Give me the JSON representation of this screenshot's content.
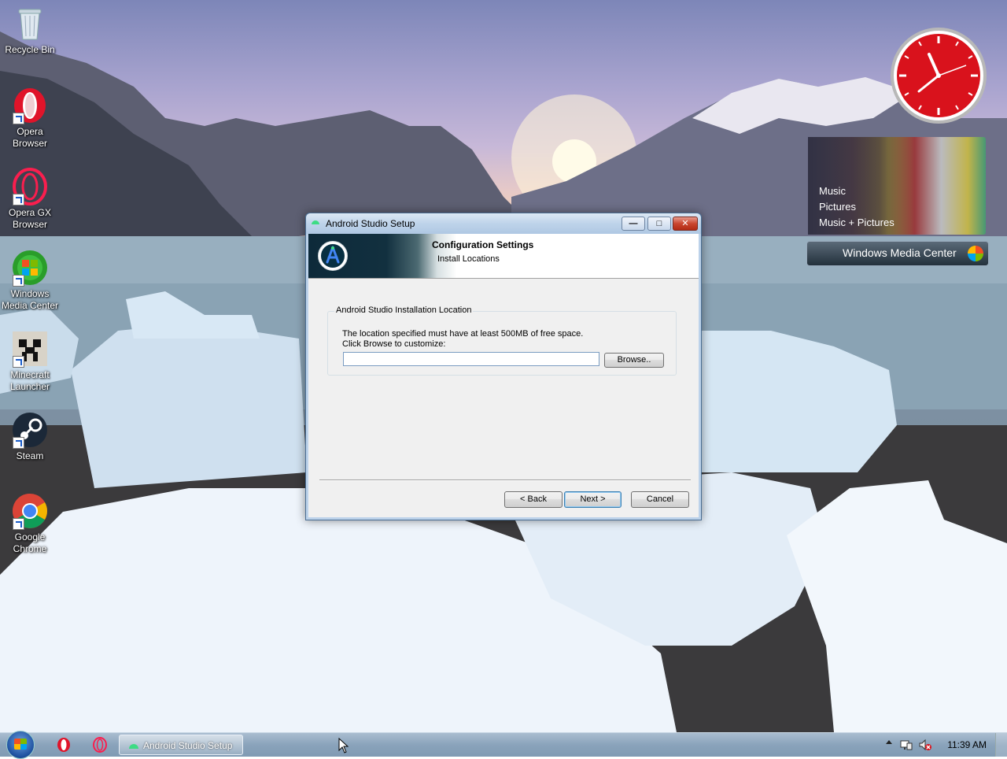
{
  "desktop": {
    "icons": [
      {
        "label": "Recycle Bin"
      },
      {
        "label": "Opera Browser"
      },
      {
        "label": "Opera GX Browser"
      },
      {
        "label": "Windows Media Center"
      },
      {
        "label": "Minecraft Launcher"
      },
      {
        "label": "Steam"
      },
      {
        "label": "Google Chrome"
      }
    ]
  },
  "gadgets": {
    "clock": {
      "time": "11:39"
    },
    "media_center": {
      "menu": [
        "Music",
        "Pictures",
        "Music + Pictures"
      ],
      "title": "Windows Media Center"
    }
  },
  "dialog": {
    "title": "Android Studio Setup",
    "header_title": "Configuration Settings",
    "header_subtitle": "Install Locations",
    "group_label": "Android Studio Installation Location",
    "description_line1": "The location specified must have at least 500MB of free space.",
    "description_line2": "Click Browse to customize:",
    "path_value": "",
    "browse_label": "Browse..",
    "back_label": "< Back",
    "next_label": "Next >",
    "cancel_label": "Cancel"
  },
  "taskbar": {
    "task_label": "Android Studio Setup",
    "clock": "11:39 AM"
  },
  "colors": {
    "accent_green": "#3ddc84",
    "opera_red": "#e0142a",
    "clock_red": "#d9121c"
  }
}
